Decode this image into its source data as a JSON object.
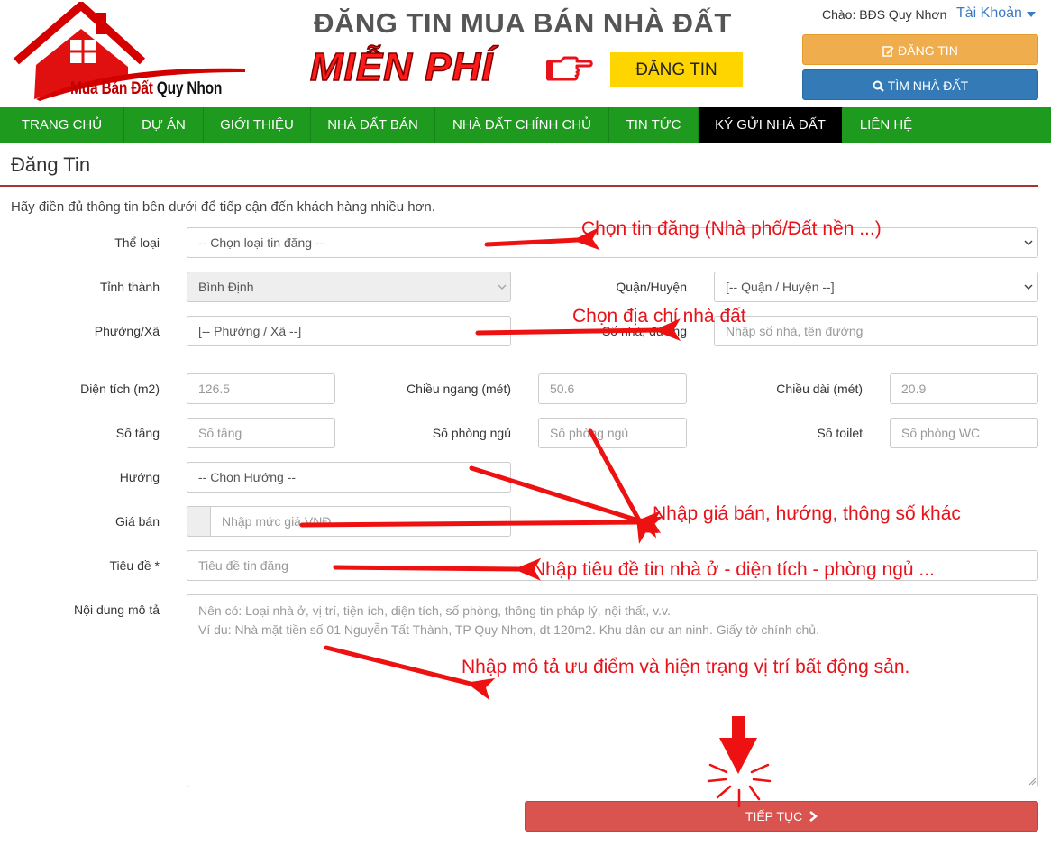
{
  "header": {
    "logo_text_part1": "Mua Bán Đất ",
    "logo_text_part2": "Quy Nhon",
    "headline": "ĐĂNG TIN MUA BÁN NHÀ ĐẤT",
    "free_text": "MIỄN PHÍ",
    "promo_button": "ĐĂNG TIN",
    "greeting": "Chào: BĐS Quy Nhơn",
    "account_link": "Tài Khoản",
    "post_button": "ĐĂNG TIN",
    "find_button": "TÌM NHÀ ĐẤT"
  },
  "nav": {
    "items": [
      {
        "label": "TRANG CHỦ"
      },
      {
        "label": "DỰ ÁN"
      },
      {
        "label": "GIỚI THIỆU"
      },
      {
        "label": "NHÀ ĐẤT BÁN"
      },
      {
        "label": "NHÀ ĐẤT CHÍNH CHỦ"
      },
      {
        "label": "TIN TỨC"
      },
      {
        "label": "KÝ GỬI NHÀ ĐẤT"
      },
      {
        "label": "LIÊN HỆ"
      }
    ],
    "active": "KÝ GỬI NHÀ ĐẤT"
  },
  "page": {
    "title": "Đăng Tin",
    "intro": "Hãy điền đủ thông tin bên dưới để tiếp cận đến khách hàng nhiều hơn."
  },
  "form": {
    "category": {
      "label": "Thể loại",
      "value": "-- Chọn loại tin đăng --"
    },
    "province": {
      "label": "Tỉnh thành",
      "value": "Bình Định"
    },
    "district": {
      "label": "Quận/Huyện",
      "value": "[-- Quận / Huyện --]"
    },
    "ward": {
      "label": "Phường/Xã",
      "value": "[-- Phường / Xã --]"
    },
    "street": {
      "label": "Số nhà, đường",
      "placeholder": "Nhập số nhà, tên đường"
    },
    "area": {
      "label": "Diện tích (m2)",
      "value": "126.5"
    },
    "width": {
      "label": "Chiều ngang (mét)",
      "value": "50.6"
    },
    "length": {
      "label": "Chiều dài (mét)",
      "value": "20.9"
    },
    "floors": {
      "label": "Số tầng",
      "placeholder": "Số tầng"
    },
    "bedrooms": {
      "label": "Số phòng ngủ",
      "placeholder": "Số phòng ngủ"
    },
    "toilets": {
      "label": "Số toilet",
      "placeholder": "Số phòng WC"
    },
    "direction": {
      "label": "Hướng",
      "value": "-- Chọn Hướng --"
    },
    "price": {
      "label": "Giá bán",
      "placeholder": "Nhập mức giá VNĐ"
    },
    "post_title": {
      "label": "Tiêu đề *",
      "placeholder": "Tiêu đề tin đăng"
    },
    "description": {
      "label": "Nội dung mô tả",
      "placeholder_line1": "Nên có: Loại nhà ở, vị trí, tiện ích, diện tích, số phòng, thông tin pháp lý, nội thất, v.v.",
      "placeholder_line2": "Ví dụ: Nhà mặt tiền số 01 Nguyễn Tất Thành, TP Quy Nhơn, dt 120m2. Khu dân cư an ninh. Giấy tờ chính chủ."
    },
    "submit": "TIẾP TỤC"
  },
  "annotations": {
    "category": "Chọn tin đăng (Nhà phố/Đất nền ...)",
    "address": "Chọn địa chỉ nhà đất",
    "specs": "Nhập giá bán, hướng, thông số khác",
    "title": "Nhập tiêu đề tin nhà ở - diện tích - phòng ngủ ...",
    "description": "Nhập mô tả ưu điểm và hiện trạng vị trí bất động sản."
  },
  "colors": {
    "nav_green": "#1e9a1e",
    "nav_active": "#000000",
    "post_orange": "#f0ad4e",
    "find_blue": "#337ab7",
    "submit_red": "#d9534f",
    "annotation_red": "#e8121a",
    "promo_yellow": "#ffd500"
  },
  "icons": [
    "house-logo-icon",
    "pointing-hand-icon",
    "edit-icon",
    "search-icon",
    "caret-down-icon",
    "chevron-right-icon",
    "arrow-icon"
  ]
}
